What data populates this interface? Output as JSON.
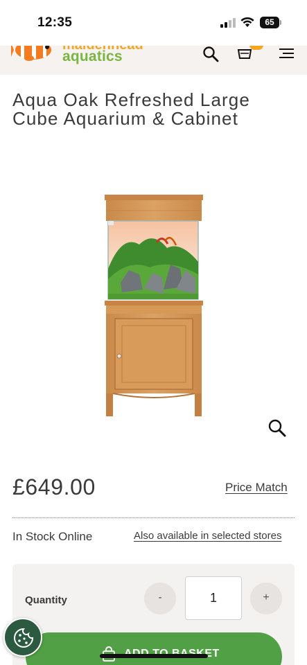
{
  "status_bar": {
    "time": "12:35",
    "battery": "65",
    "icons": [
      "signal-icon",
      "wifi-icon",
      "battery-icon"
    ]
  },
  "header": {
    "logo_text_top": "maidenhead",
    "logo_text": "aquatics",
    "icons": [
      "search-icon",
      "basket-icon",
      "menu-icon"
    ],
    "colors": {
      "logo_green": "#7ab541",
      "logo_orange": "#f5a623",
      "header_bg": "#f5f2f0"
    }
  },
  "product": {
    "title": "Aqua Oak Refreshed Large Cube Aquarium & Cabinet",
    "image": "aquarium-cabinet-image",
    "price": "£649.00",
    "price_match_label": "Price Match",
    "stock_status": "In Stock Online",
    "stores_link": "Also available in selected stores"
  },
  "purchase": {
    "quantity_label": "Quantity",
    "quantity_value": "1",
    "decrement_label": "-",
    "increment_label": "+",
    "add_to_basket_label": "ADD TO BASKET",
    "colors": {
      "button_green": "#52a046",
      "cookie_green": "#2b5a40"
    }
  }
}
